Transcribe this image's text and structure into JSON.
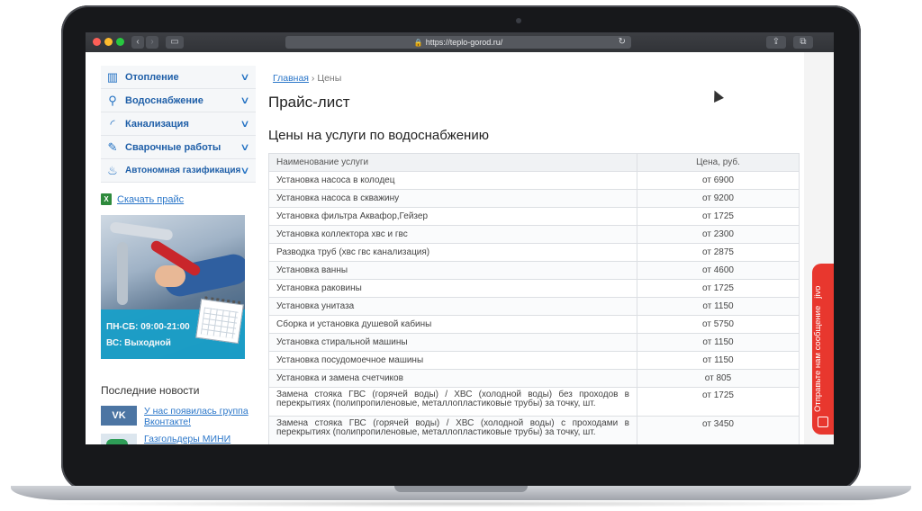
{
  "browser": {
    "url": "https://teplo-gorod.ru/"
  },
  "sidebar": {
    "menu": [
      {
        "label": "Отопление",
        "icon": "radiator-icon"
      },
      {
        "label": "Водоснабжение",
        "icon": "faucet-icon"
      },
      {
        "label": "Канализация",
        "icon": "pipe-icon"
      },
      {
        "label": "Сварочные работы",
        "icon": "welding-icon"
      },
      {
        "label": "Автономная газификация",
        "icon": "gas-flame-icon"
      }
    ],
    "download_label": "Скачать прайс",
    "promo": {
      "hours": "ПН-СБ: 09:00-21:00",
      "dayoff": "ВС: Выходной"
    },
    "news_title": "Последние новости",
    "news": [
      {
        "text": "У нас появилась группа Вконтакте!",
        "icon": "vk-icon"
      },
      {
        "text": "Газгольдеры МИНИ",
        "icon": "gas-tank-icon"
      }
    ]
  },
  "breadcrumb": {
    "home": "Главная",
    "separator": "›",
    "current": "Цены"
  },
  "page_title": "Прайс-лист",
  "section_title": "Цены на услуги по водоснабжению",
  "table": {
    "headers": [
      "Наименование услуги",
      "Цена, руб."
    ],
    "rows": [
      [
        "Установка насоса в колодец",
        "от 6900"
      ],
      [
        "Установка насоса в скважину",
        "от 9200"
      ],
      [
        "Установка фильтра Аквафор,Гейзер",
        "от 1725"
      ],
      [
        "Установка коллектора хвс и гвс",
        "от 2300"
      ],
      [
        "Разводка труб (хвс гвс канализация)",
        "от 2875"
      ],
      [
        "Установка ванны",
        "от 4600"
      ],
      [
        "Установка раковины",
        "от 1725"
      ],
      [
        "Установка унитаза",
        "от 1150"
      ],
      [
        "Сборка и установка душевой кабины",
        "от 5750"
      ],
      [
        "Установка стиральной машины",
        "от 1150"
      ],
      [
        "Установка посудомоечное машины",
        "от 1150"
      ],
      [
        "Установка и замена счетчиков",
        "от 805"
      ],
      [
        "Замена стояка ГВС (горячей воды) / ХВС (холодной воды) без проходов в перекрытиях (полипропиленовые, металлопластиковые трубы) за точку, шт.",
        "от 1725"
      ],
      [
        "Замена стояка ГВС (горячей воды) / ХВС (холодной воды) с проходами в перекрытиях (полипропиленовые, металлопластиковые трубы) за точку, шт.",
        "от 3450"
      ]
    ]
  },
  "chat": {
    "label": "Отправьте нам сообщение",
    "brand": "jivo",
    "color": "#e8372e"
  },
  "colors": {
    "link": "#2a76c9",
    "menu_text": "#1f5fa8",
    "promo_band": "#1aa0c9"
  }
}
